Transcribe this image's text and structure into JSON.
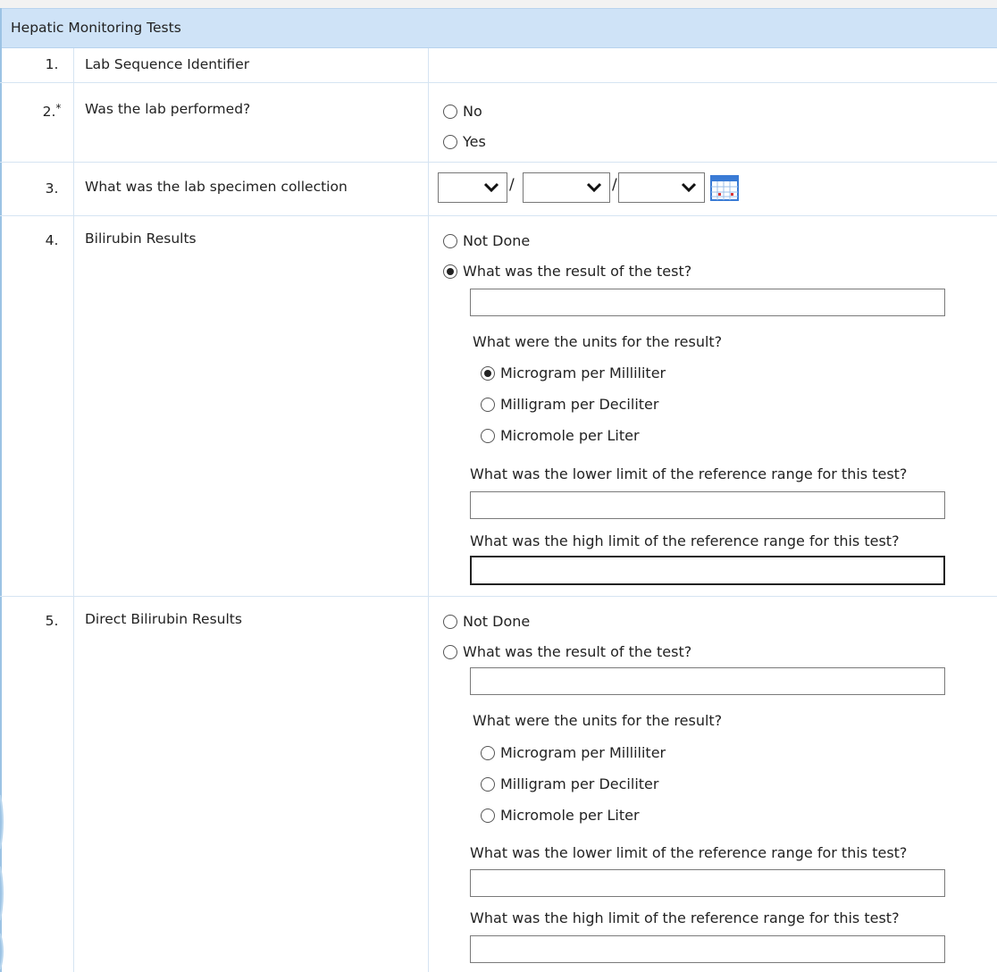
{
  "section": {
    "title": "Hepatic Monitoring Tests"
  },
  "q1": {
    "number": "1.",
    "label": "Lab Sequence Identifier"
  },
  "q2": {
    "number": "2.",
    "required_mark": "*",
    "label": "Was the lab performed?",
    "options": [
      "No",
      "Yes"
    ]
  },
  "q3": {
    "number": "3.",
    "label": "What was the lab specimen collection",
    "date_separator": "/",
    "icons": [
      "chevron-down-icon",
      "calendar-icon"
    ]
  },
  "q4": {
    "number": "4.",
    "label": "Bilirubin Results",
    "not_done": "Not Done",
    "result_prompt": "What was the result of the test?",
    "result_selected": true,
    "result_value": "",
    "units_prompt": "What were the units for the result?",
    "units": [
      "Microgram per Milliliter",
      "Milligram per Deciliter",
      "Micromole per Liter"
    ],
    "units_selected": "Microgram per Milliliter",
    "lower_prompt": "What was the lower limit of the reference range for this test?",
    "high_prompt": "What was the high limit of the reference range for this test?"
  },
  "q5": {
    "number": "5.",
    "label": "Direct Bilirubin Results",
    "not_done": "Not Done",
    "result_prompt": "What was the result of the test?",
    "units_prompt": "What were the units for the result?",
    "units": [
      "Microgram per Milliliter",
      "Milligram per Deciliter",
      "Micromole per Liter"
    ],
    "lower_prompt": "What was the lower limit of the reference range for this test?",
    "high_prompt": "What was the high limit of the reference range for this test?"
  },
  "colors": {
    "header_bg": "#cfe3f7",
    "grid_line": "#d6e4f2",
    "calendar_accent": "#3a7bd5"
  }
}
